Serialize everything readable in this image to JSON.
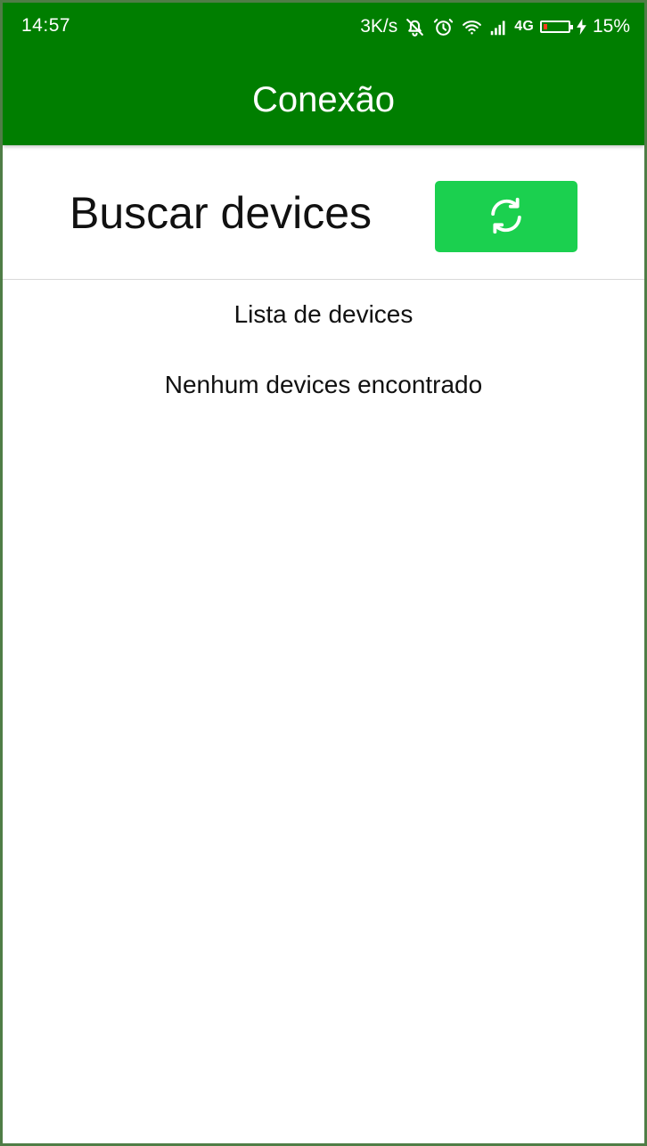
{
  "status_bar": {
    "time": "14:57",
    "network_speed": "3K/s",
    "network_type": "4G",
    "battery_percent": "15%",
    "battery_level": 0.15,
    "icons": [
      "bell-off-icon",
      "alarm-icon",
      "wifi-icon",
      "signal-icon",
      "battery-icon",
      "charging-icon"
    ]
  },
  "app_bar": {
    "title": "Conexão",
    "background_color": "#007e00"
  },
  "search": {
    "label": "Buscar devices",
    "button_icon": "refresh-icon",
    "button_color": "#1bd04f"
  },
  "device_list": {
    "title": "Lista de devices",
    "empty_message": "Nenhum devices encontrado"
  }
}
